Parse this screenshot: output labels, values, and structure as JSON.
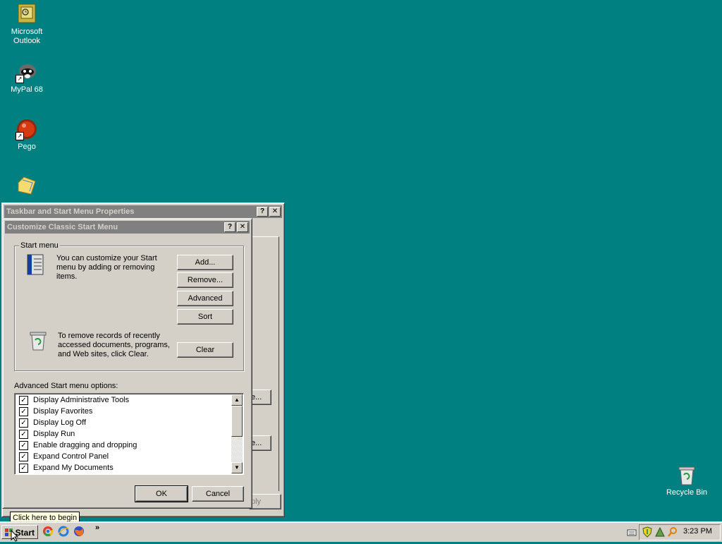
{
  "desktop": {
    "icons": [
      {
        "label": "Microsoft\nOutlook",
        "icon": "outlook-icon"
      },
      {
        "label": "MyPal 68",
        "icon": "raccoon-icon"
      },
      {
        "label": "Pego",
        "icon": "pego-icon"
      },
      {
        "label": "",
        "icon": "folder-icon"
      },
      {
        "label": "Recycle Bin",
        "icon": "recycle-bin-icon"
      }
    ]
  },
  "outer_window": {
    "title": "Taskbar and Start Menu Properties",
    "hidden_button_1": "e...",
    "hidden_button_2": "e...",
    "apply_label": "ply"
  },
  "dialog": {
    "title": "Customize Classic Start Menu",
    "group_label": "Start menu",
    "description1": "You can customize your Start menu by adding or removing items.",
    "description2": "To remove records of recently accessed documents, programs, and Web sites, click Clear.",
    "buttons": {
      "add": "Add...",
      "remove": "Remove...",
      "advanced": "Advanced",
      "sort": "Sort",
      "clear": "Clear",
      "ok": "OK",
      "cancel": "Cancel"
    },
    "options_label": "Advanced Start menu options:",
    "options": [
      {
        "label": "Display Administrative Tools",
        "checked": true
      },
      {
        "label": "Display Favorites",
        "checked": true
      },
      {
        "label": "Display Log Off",
        "checked": true
      },
      {
        "label": "Display Run",
        "checked": true
      },
      {
        "label": "Enable dragging and dropping",
        "checked": true
      },
      {
        "label": "Expand Control Panel",
        "checked": true
      },
      {
        "label": "Expand My Documents",
        "checked": true
      }
    ]
  },
  "taskbar": {
    "start_label": "Start",
    "tooltip": "Click here to begin",
    "overflow": "»",
    "clock": "3:23 PM"
  }
}
